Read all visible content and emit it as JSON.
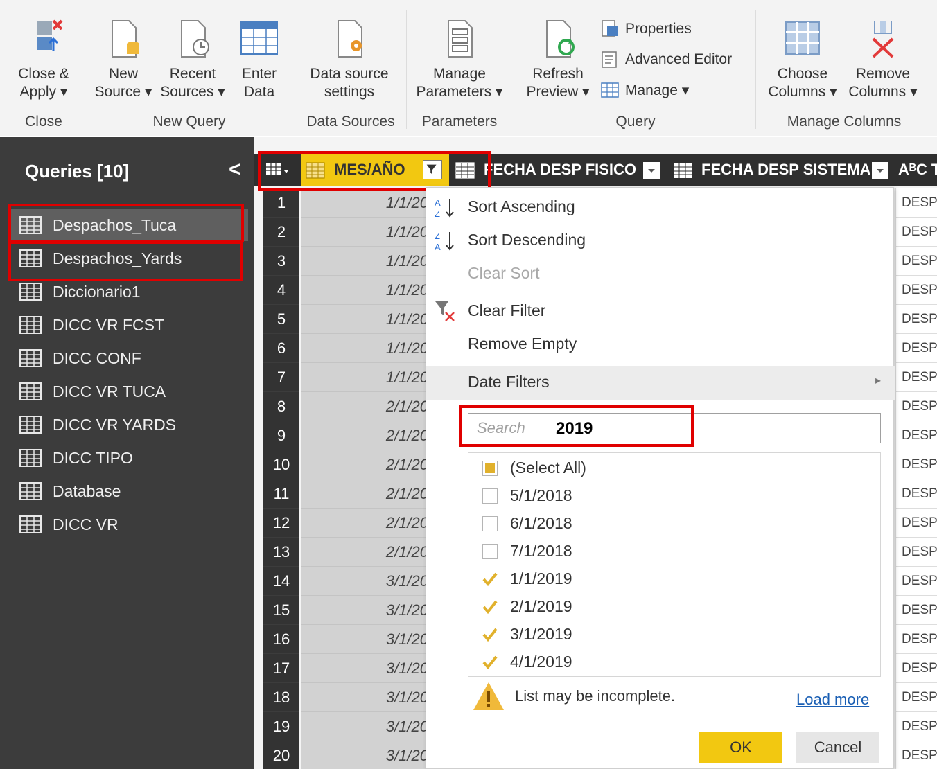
{
  "ribbon": {
    "close_apply": "Close &\nApply ▾",
    "new_source": "New\nSource ▾",
    "recent_sources": "Recent\nSources ▾",
    "enter_data": "Enter\nData",
    "data_source_settings": "Data source\nsettings",
    "manage_parameters": "Manage\nParameters ▾",
    "refresh_preview": "Refresh\nPreview ▾",
    "properties": "Properties",
    "advanced_editor": "Advanced Editor",
    "manage": "Manage ▾",
    "choose_columns": "Choose\nColumns ▾",
    "remove_columns": "Remove\nColumns ▾",
    "groups": {
      "close": "Close",
      "new_query": "New Query",
      "data_sources": "Data Sources",
      "parameters": "Parameters",
      "query": "Query",
      "manage_columns": "Manage Columns"
    }
  },
  "queries": {
    "title": "Queries [10]",
    "collapse": "<",
    "items": [
      "Despachos_Tuca",
      "Despachos_Yards",
      "Diccionario1",
      "DICC VR FCST",
      "DICC CONF",
      "DICC VR TUCA",
      "DICC VR YARDS",
      "DICC TIPO",
      "Database",
      "DICC VR"
    ]
  },
  "grid": {
    "columns": [
      "MES/AÑO",
      "FECHA DESP FISICO",
      "FECHA DESP SISTEMA",
      "AᴮC T"
    ],
    "row_numbers": [
      "1",
      "2",
      "3",
      "4",
      "5",
      "6",
      "7",
      "8",
      "9",
      "10",
      "11",
      "12",
      "13",
      "14",
      "15",
      "16",
      "17",
      "18",
      "19",
      "20"
    ],
    "mes_values": [
      "1/1/20",
      "1/1/20",
      "1/1/20",
      "1/1/20",
      "1/1/20",
      "1/1/20",
      "1/1/20",
      "2/1/20",
      "2/1/20",
      "2/1/20",
      "2/1/20",
      "2/1/20",
      "2/1/20",
      "3/1/20",
      "3/1/20",
      "3/1/20",
      "3/1/20",
      "3/1/20",
      "3/1/20",
      "3/1/20"
    ],
    "right_values": [
      "DESP",
      "DESP",
      "DESP",
      "DESP",
      "DESP",
      "DESP",
      "DESP",
      "DESP",
      "DESP",
      "DESP",
      "DESP",
      "DESP",
      "DESP",
      "DESP",
      "DESP",
      "DESP",
      "DESP",
      "DESP",
      "DESP",
      "DESP"
    ]
  },
  "dropdown": {
    "sort_asc": "Sort Ascending",
    "sort_desc": "Sort Descending",
    "clear_sort": "Clear Sort",
    "clear_filter": "Clear Filter",
    "remove_empty": "Remove Empty",
    "date_filters": "Date Filters",
    "search_placeholder": "Search",
    "search_value": "2019",
    "list": [
      {
        "label": "(Select All)",
        "state": "partial"
      },
      {
        "label": "5/1/2018",
        "state": "unchecked"
      },
      {
        "label": "6/1/2018",
        "state": "unchecked"
      },
      {
        "label": "7/1/2018",
        "state": "unchecked"
      },
      {
        "label": "1/1/2019",
        "state": "checked"
      },
      {
        "label": "2/1/2019",
        "state": "checked"
      },
      {
        "label": "3/1/2019",
        "state": "checked"
      },
      {
        "label": "4/1/2019",
        "state": "checked"
      }
    ],
    "warning": "List may be incomplete.",
    "load_more": "Load more",
    "ok": "OK",
    "cancel": "Cancel"
  },
  "colors": {
    "accent_yellow": "#f2c811",
    "highlight_red": "#e00000",
    "panel_dark": "#3c3c3c",
    "link_blue": "#1a5fb4"
  }
}
